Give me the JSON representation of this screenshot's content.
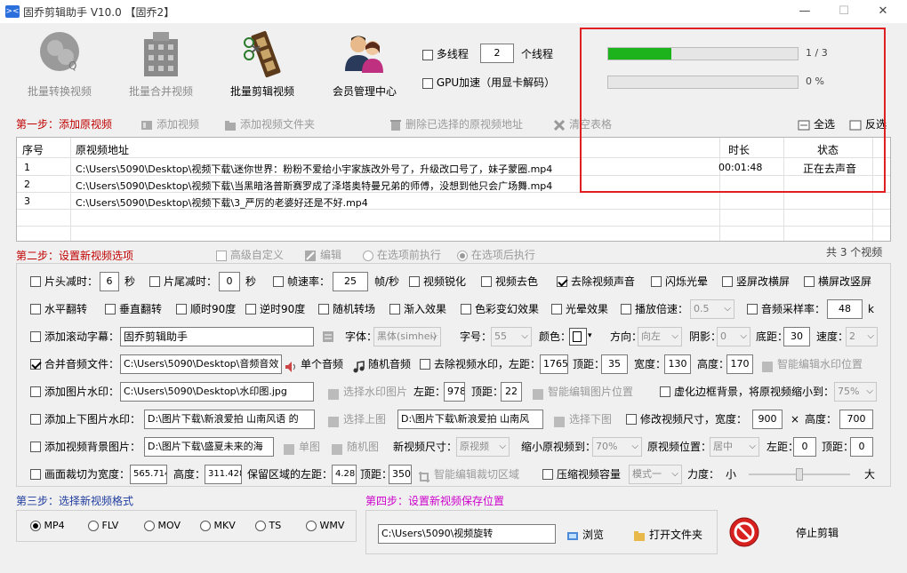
{
  "window": {
    "title": "固乔剪辑助手 V10.0  【固乔2】",
    "logo_text": "><",
    "min_glyph": "—",
    "max_glyph": "☐",
    "close_glyph": "✕"
  },
  "toolbar": {
    "batch_convert": "批量转换视频",
    "batch_merge": "批量合并视频",
    "batch_clip": "批量剪辑视频",
    "member": "会员管理中心",
    "multithread_label": "多线程",
    "thread_count": "2",
    "thread_unit": "个线程",
    "gpu_label": "GPU加速（用显卡解码）"
  },
  "progress": {
    "bar1_fraction": 0.333,
    "bar1_text": "1 / 3",
    "bar2_fraction": 0,
    "bar2_text": "0 %",
    "fill_color": "#1db31d",
    "highlight_color": "#e02020"
  },
  "step1": {
    "title": "第一步：添加原视频",
    "add_video": "添加视频",
    "add_folder": "添加视频文件夹",
    "delete_selected": "删除已选择的原视频地址",
    "clear_table": "清空表格",
    "select_all": "全选",
    "invert": "反选"
  },
  "table": {
    "headers": [
      "序号",
      "原视频地址",
      "时长",
      "状态"
    ],
    "rows": [
      {
        "no": "1",
        "path": "C:\\Users\\5090\\Desktop\\视频下载\\迷你世界：粉粉不爱给小宇家族改外号了，升级改口号了，妹子蒙圈.mp4",
        "duration": "00:01:48",
        "status": "正在去声音"
      },
      {
        "no": "2",
        "path": "C:\\Users\\5090\\Desktop\\视频下载\\当黑暗洛普斯赛罗成了泽塔奥特曼兄弟的师傅，没想到他只会广场舞.mp4",
        "duration": "",
        "status": ""
      },
      {
        "no": "3",
        "path": "C:\\Users\\5090\\Desktop\\视频下载\\3_严厉的老婆好还是不好.mp4",
        "duration": "",
        "status": ""
      }
    ]
  },
  "step2": {
    "title": "第二步：设置新视频选项",
    "advanced": "高级自定义",
    "edit": "编辑",
    "before_exec": "在选项前执行",
    "after_exec": "在选项后执行",
    "total": "共 3 个视频"
  },
  "options": {
    "r1": {
      "head_cut": "片头减时：",
      "head_val": "6",
      "head_unit": "秒",
      "tail_cut": "片尾减时：",
      "tail_val": "0",
      "tail_unit": "秒",
      "fps": "帧速率：",
      "fps_val": "25",
      "fps_unit": "帧/秒",
      "sharpen": "视频锐化",
      "decolor": "视频去色",
      "mute": "去除视频声音",
      "flash": "闪烁光晕",
      "v2h": "竖屏改横屏",
      "h2v": "横屏改竖屏"
    },
    "r2": {
      "hflip": "水平翻转",
      "vflip": "垂直翻转",
      "cw90": "顺时90度",
      "ccw90": "逆时90度",
      "random_trans": "随机转场",
      "fadein": "渐入效果",
      "colorfx": "色彩变幻效果",
      "halo": "光晕效果",
      "speed": "播放倍速：",
      "speed_val": "0.5",
      "sample": "音频采样率：",
      "sample_val": "48",
      "sample_unit": "k"
    },
    "r3": {
      "scroll": "添加滚动字幕：",
      "scroll_text": "固乔剪辑助手",
      "font": "字体：",
      "font_val": "黑体(simhei)",
      "size": "字号：",
      "size_val": "55",
      "color": "颜色：",
      "dir": "方向：",
      "dir_val": "向左",
      "shadow": "阴影：",
      "shadow_val": "0",
      "bottom": "底距：",
      "bottom_val": "30",
      "spd": "速度：",
      "spd_val": "2"
    },
    "r4": {
      "merge_audio": "合并音频文件：",
      "audio_path": "C:\\Users\\5090\\Desktop\\音频音效",
      "single": "单个音频",
      "random": "随机音频",
      "remove_wm": "去除视频水印，左距：",
      "left_val": "1765",
      "top": "顶距：",
      "top_val": "35",
      "width": "宽度：",
      "width_val": "130",
      "height": "高度：",
      "height_val": "170",
      "smart_wm": "智能编辑水印位置"
    },
    "r5": {
      "img_wm": "添加图片水印：",
      "img_path": "C:\\Users\\5090\\Desktop\\水印图.jpg",
      "choose_img": "选择水印图片",
      "left": "左距：",
      "left_val": "978",
      "top": "顶距：",
      "top_val": "22",
      "smart_img": "智能编辑图片位置",
      "blur_bg": "虚化边框背景，将原视频缩小到：",
      "blur_val": "75%"
    },
    "r6": {
      "tb_img": "添加上下图片水印：",
      "top_path": "D:\\图片下载\\新浪爱拍 山南风语 的",
      "choose_top": "选择上图",
      "bottom_path": "D:\\图片下载\\新浪爱拍 山南风",
      "choose_bottom": "选择下图",
      "resize": "修改视频尺寸，宽度：",
      "w_val": "900",
      "times": "×",
      "h_label": "高度：",
      "h_val": "700"
    },
    "r7": {
      "bg_img": "添加视频背景图片：",
      "bg_path": "D:\\图片下载\\盛夏未来的海",
      "single_img": "单图",
      "random_img": "随机图",
      "new_size": "新视频尺寸：",
      "new_size_val": "原视频",
      "shrink": "缩小原视频到：",
      "shrink_val": "70%",
      "pos": "原视频位置：",
      "pos_val": "居中",
      "left": "左距：",
      "left_val": "0",
      "top": "顶距：",
      "top_val": "0"
    },
    "r8": {
      "crop": "画面裁切为宽度：",
      "crop_w": "565.714",
      "crop_h_label": "高度：",
      "crop_h": "311.428",
      "keep_left": "保留区域的左距：",
      "keep_left_val": "4.28",
      "top": "顶距：",
      "top_val": "350",
      "smart_crop": "智能编辑裁切区域",
      "compress": "压缩视频容量",
      "mode_val": "模式一",
      "force": "力度：",
      "small": "小",
      "big": "大",
      "force_fraction": 0.5
    }
  },
  "step3": {
    "title": "第三步：选择新视频格式",
    "formats": [
      "MP4",
      "FLV",
      "MOV",
      "MKV",
      "TS",
      "WMV"
    ]
  },
  "step4": {
    "title": "第四步：设置新视频保存位置",
    "path": "C:\\Users\\5090\\视频旋转",
    "browse": "浏览",
    "open_folder": "打开文件夹",
    "stop": "停止剪辑"
  }
}
